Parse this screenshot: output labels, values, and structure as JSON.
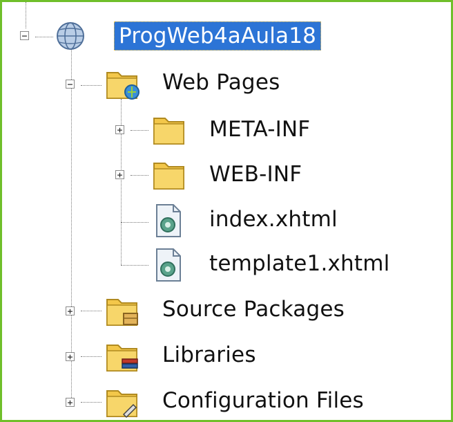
{
  "tree": {
    "project": {
      "label": "ProgWeb4aAula18",
      "icon": "globe-project-icon",
      "expander": "−"
    },
    "web_pages": {
      "label": "Web Pages",
      "icon": "web-pages-folder-icon",
      "expander": "−"
    },
    "meta_inf": {
      "label": "META-INF",
      "icon": "folder-icon",
      "expander": "+"
    },
    "web_inf": {
      "label": "WEB-INF",
      "icon": "folder-icon",
      "expander": "+"
    },
    "index": {
      "label": "index.xhtml",
      "icon": "xhtml-file-icon"
    },
    "template": {
      "label": "template1.xhtml",
      "icon": "xhtml-file-icon"
    },
    "source_packages": {
      "label": "Source Packages",
      "icon": "package-folder-icon",
      "expander": "+"
    },
    "libraries": {
      "label": "Libraries",
      "icon": "library-folder-icon",
      "expander": "+"
    },
    "config_files": {
      "label": "Configuration Files",
      "icon": "config-folder-icon",
      "expander": "+"
    }
  },
  "colors": {
    "selection": "#2c74d6",
    "frame": "#6fbf2a",
    "folder": "#f3c74a"
  }
}
